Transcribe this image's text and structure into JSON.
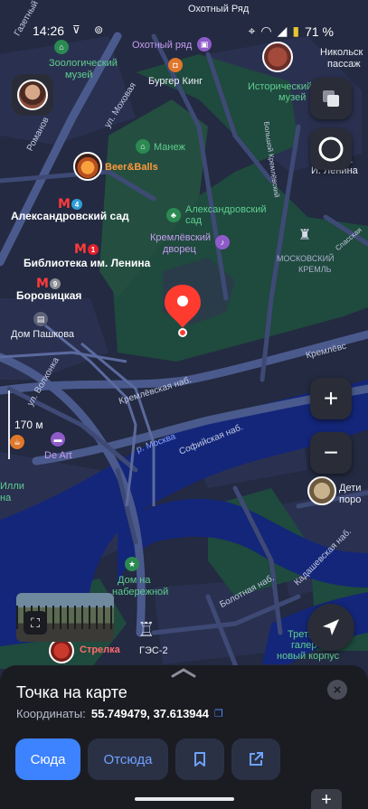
{
  "status_bar": {
    "time": "14:26",
    "battery": "71 %"
  },
  "map": {
    "scale": "170 м",
    "labels": {
      "okhotny_ryad_top": "Охотный Ряд",
      "okhotny_ryad_mall": "Охотный ряд",
      "zoo_museum_1": "Зоологический",
      "zoo_museum_2": "музей",
      "burger_king": "Бургер Кинг",
      "hist_museum_1": "Исторический",
      "hist_museum_2": "музей",
      "nikolskaya_1": "Никольск",
      "nikolskaya_2": "пассаж",
      "gazetny": "Газетный",
      "romanov": "Романов",
      "manezh": "Манеж",
      "mokhovaya": "ул. Моховая",
      "bolshoy_kamenny": "Большой Кремлёвский",
      "bolshoy_kamenny_2": "дворец",
      "lenina_1": "В.",
      "lenina_2": "И. Ленина",
      "beer_balls": "Beer&Balls",
      "alex_garden_station": "Александровский сад",
      "alex_garden_park_1": "Александровский",
      "alex_garden_park_2": "сад",
      "kremlin_palace_1": "Кремлёвский",
      "kremlin_palace_2": "дворец",
      "kremlin_1": "МОСКОВСКИЙ",
      "kremlin_2": "КРЕМЛЬ",
      "spasskaya": "Спасская",
      "lenin_library": "Библиотека им. Ленина",
      "borovitskaya": "Боровицкая",
      "dom_pashkova": "Дом Пашкова",
      "volkhonka": "ул. Волхонка",
      "kremlin_emb_1": "Кремлёвская наб.",
      "kremlin_emb_2": "Кремлёвская наб.",
      "kremlin_emb_3": "Кремлёвс",
      "moskva_river": "р. Москва",
      "sofiyskaya": "Софийская наб.",
      "de_art": "De Art",
      "ilyi_1": "Илли",
      "ilyi_2": "на",
      "detiy_1": "Дети",
      "detiy_2": "поро",
      "dom_emb_1": "Дом на",
      "dom_emb_2": "набережной",
      "bolotnaya": "Болотная наб.",
      "kadashevskaya": "Кадашевская наб.",
      "strelka": "Стрелка",
      "ges2": "ГЭС-2",
      "tretyakov_1": "Третья",
      "tretyakov_2": "галер",
      "tretyakov_3": "новый корпус"
    },
    "metro": [
      {
        "line": "4",
        "color": "#2f9fd6"
      },
      {
        "line": "1",
        "color": "#e3202c"
      },
      {
        "line": "9",
        "color": "#8c8e94"
      }
    ],
    "metro_symbol": "M"
  },
  "sheet": {
    "title": "Точка на карте",
    "coords_label": "Координаты:",
    "coords_value": "55.749479, 37.613944",
    "buttons": {
      "here": "Сюда",
      "from": "Отсюда"
    }
  }
}
